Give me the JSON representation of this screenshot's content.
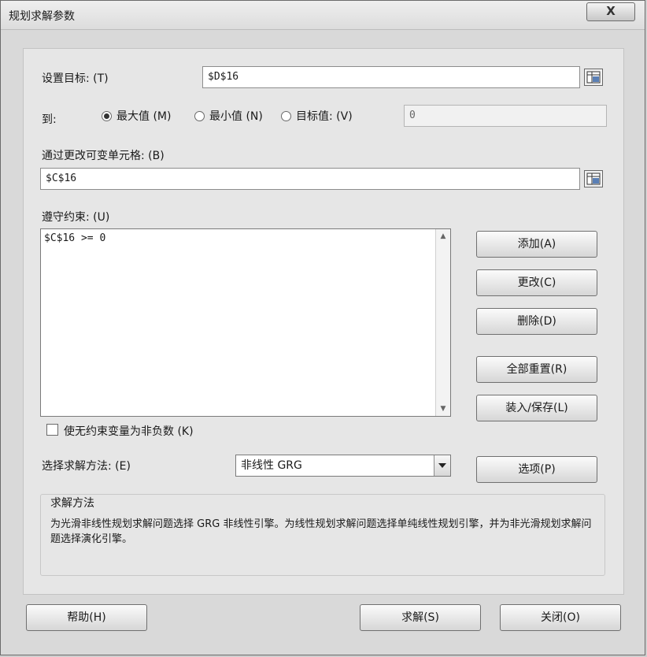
{
  "window": {
    "title": "规划求解参数",
    "close_label": "X"
  },
  "target": {
    "label": "设置目标: (T)",
    "value": "$D$16"
  },
  "to": {
    "label": "到:",
    "options": [
      {
        "label": "最大值 (M)",
        "selected": true
      },
      {
        "label": "最小值 (N)",
        "selected": false
      },
      {
        "label": "目标值: (V)",
        "selected": false
      }
    ],
    "value_of": "0"
  },
  "changing_cells": {
    "label": "通过更改可变单元格: (B)",
    "value": "$C$16"
  },
  "constraints": {
    "label": "遵守约束: (U)",
    "items": [
      "$C$16 >= 0"
    ]
  },
  "buttons": {
    "add": "添加(A)",
    "change": "更改(C)",
    "delete": "删除(D)",
    "reset_all": "全部重置(R)",
    "load_save": "装入/保存(L)",
    "options": "选项(P)",
    "help": "帮助(H)",
    "solve": "求解(S)",
    "close": "关闭(O)"
  },
  "non_negative": {
    "label": "使无约束变量为非负数 (K)",
    "checked": false
  },
  "method": {
    "label": "选择求解方法: (E)",
    "value": "非线性 GRG"
  },
  "method_group": {
    "title": "求解方法",
    "description": "为光滑非线性规划求解问题选择 GRG 非线性引擎。为线性规划求解问题选择单纯线性规划引擎，并为非光滑规划求解问题选择演化引擎。"
  }
}
